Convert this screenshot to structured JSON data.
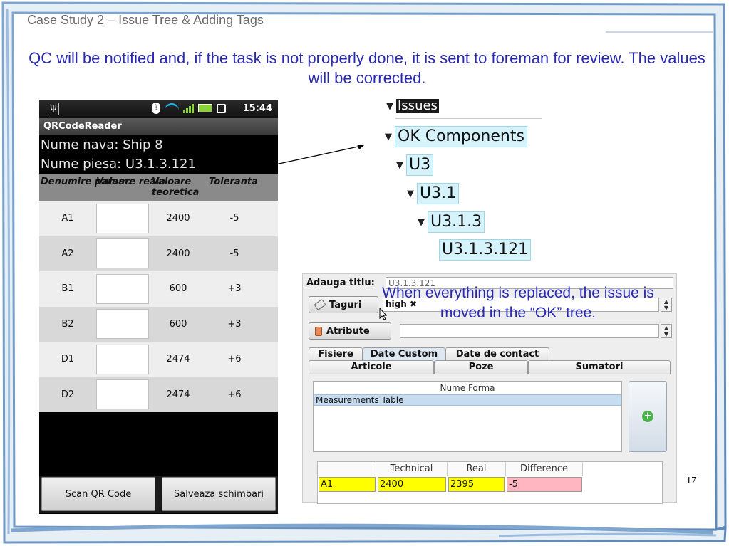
{
  "slide": {
    "title": "Case Study 2 – Issue Tree & Adding Tags",
    "subtitle": "QC will be notified and, if the task is not properly done, it is sent to foreman for review. The values will be corrected.",
    "page_number": "17",
    "overlay_text": "When everything is replaced, the issue is moved in the “OK” tree."
  },
  "phone": {
    "status": {
      "time": "15:44",
      "icons": [
        "usb-icon",
        "bluetooth-icon",
        "wifi-icon",
        "signal-icon",
        "battery-icon",
        "alarm-icon"
      ]
    },
    "app_title": "QRCodeReader",
    "ship_line": "Nume nava: Ship 8",
    "part_line": "Nume piesa: U3.1.3.121",
    "headers": [
      "Denumire param.",
      "Valoare reala",
      "Valoare teoretica",
      "Toleranta"
    ],
    "rows": [
      {
        "name": "A1",
        "real": "",
        "theoretical": "2400",
        "tolerance": "-5"
      },
      {
        "name": "A2",
        "real": "",
        "theoretical": "2400",
        "tolerance": "-5"
      },
      {
        "name": "B1",
        "real": "",
        "theoretical": "600",
        "tolerance": "+3"
      },
      {
        "name": "B2",
        "real": "",
        "theoretical": "600",
        "tolerance": "+3"
      },
      {
        "name": "D1",
        "real": "",
        "theoretical": "2474",
        "tolerance": "+6"
      },
      {
        "name": "D2",
        "real": "",
        "theoretical": "2474",
        "tolerance": "+6"
      }
    ],
    "buttons": {
      "scan": "Scan QR Code",
      "save": "Salveaza schimbari"
    }
  },
  "tree": {
    "issues": "Issues",
    "nodes": [
      "OK Components",
      "U3",
      "U3.1",
      "U3.1.3",
      "U3.1.3.121"
    ]
  },
  "panel": {
    "title_label": "Adauga titlu:",
    "title_value": "U3.1.3.121",
    "tags_button": "Taguri",
    "tag_value": "high ✖",
    "attr_button": "Atribute",
    "tabs_row1": [
      "Fisiere",
      "Date Custom",
      "Date de contact"
    ],
    "tabs_row2": [
      "Articole",
      "Poze",
      "Sumatori"
    ],
    "forms_header": "Nume Forma",
    "forms_rows": [
      "Measurements Table"
    ],
    "meas_headers": [
      "",
      "Technical",
      "Real",
      "Difference"
    ],
    "meas_row": [
      "A1",
      "2400",
      "2395",
      "-5"
    ],
    "colors": {
      "highlight_yellow": "#ffff00",
      "highlight_pink": "#ffb6c1",
      "accent_blue": "#2a2ab0"
    }
  }
}
